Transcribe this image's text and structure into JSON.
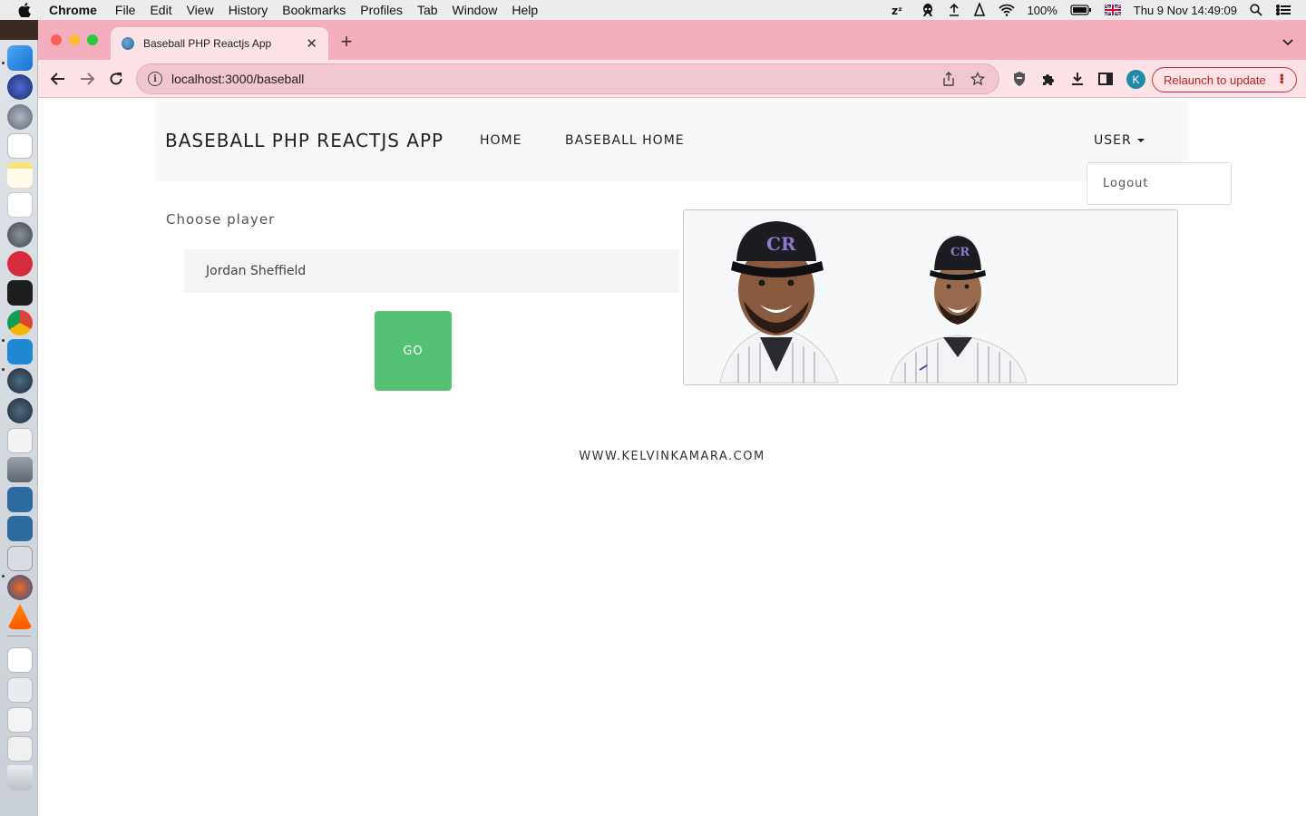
{
  "menubar": {
    "app_name": "Chrome",
    "items": [
      "File",
      "Edit",
      "View",
      "History",
      "Bookmarks",
      "Profiles",
      "Tab",
      "Window",
      "Help"
    ],
    "battery": "100%",
    "datetime": "Thu 9 Nov  14:49:09"
  },
  "browser": {
    "tab_title": "Baseball PHP Reactjs App",
    "url": "localhost:3000/baseball",
    "profile_initial": "K",
    "relaunch_label": "Relaunch to update"
  },
  "page": {
    "brand": "BASEBALL PHP REACTJS APP",
    "nav": {
      "home": "HOME",
      "baseball_home": "BASEBALL HOME",
      "user": "USER"
    },
    "dropdown": {
      "logout": "Logout"
    },
    "form": {
      "label": "Choose player",
      "selected_player": "Jordan Sheffield",
      "go_label": "GO"
    },
    "footer": "WWW.KELVINKAMARA.COM"
  },
  "colors": {
    "tabstrip": "#f4aebe",
    "toolbar": "#fde3e8",
    "go_button": "#55c172",
    "relaunch": "#b3261e"
  }
}
